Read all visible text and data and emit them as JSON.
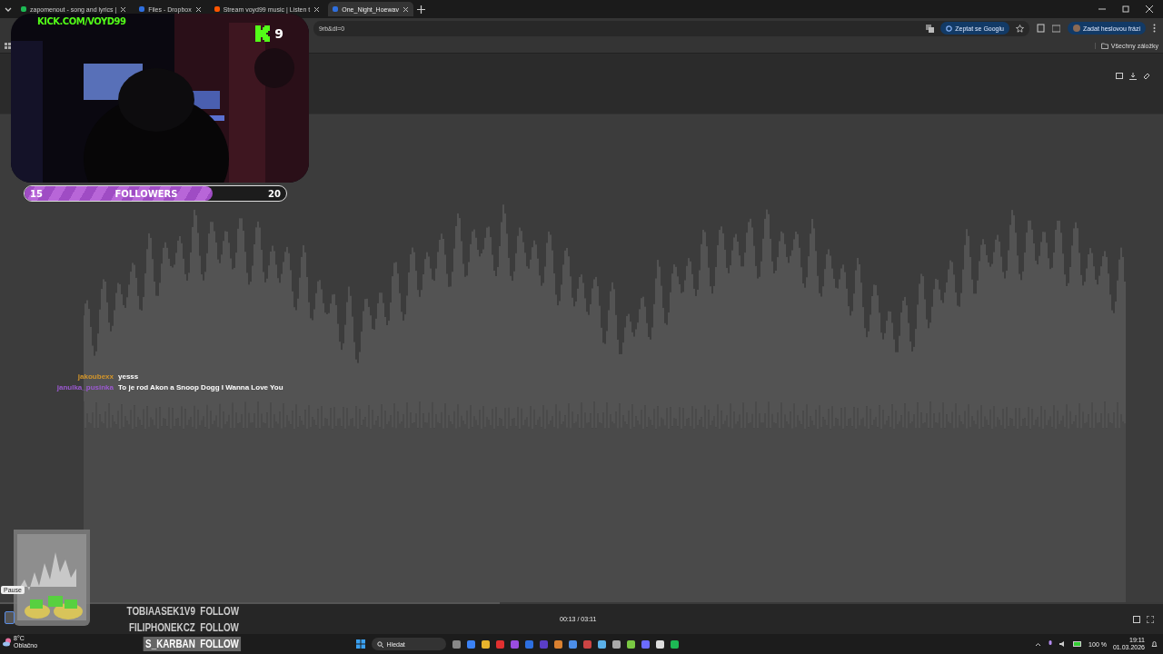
{
  "tabs": [
    {
      "title": "zapomenout - song and lyrics |",
      "selected": false
    },
    {
      "title": "Files - Dropbox",
      "selected": false
    },
    {
      "title": "Stream voyd99 music | Listen t",
      "selected": false
    },
    {
      "title": "One_Night_Hoewav",
      "selected": true
    }
  ],
  "address_fragment": "9rb&dl=0",
  "toolbar_buttons": [
    "Zeptat se Googlu",
    "Zadat heslovou frázi"
  ],
  "bookmarks": {
    "all": "Všechny záložky"
  },
  "overlay": {
    "channel": "KICK.COM/VOYD99",
    "viewers": "9",
    "followers": {
      "start": "15",
      "label": "FOLLOWERS",
      "goal": "20",
      "level": 0.72
    }
  },
  "chat": [
    {
      "user": "jakoubexx",
      "color": "#d4962a",
      "message": "yesss"
    },
    {
      "user": "janulka_pusinka",
      "color": "#9b59d0",
      "message": "To je rod Akon a Snoop Dogg I Wanna Love You"
    }
  ],
  "player": {
    "time": "00:13 / 03:11",
    "progress": {
      "level": 0.43
    },
    "tooltip": "Pause"
  },
  "recent_follows": [
    {
      "name": "TOBIAASEK1V9",
      "action": "FOLLOW",
      "selected": false
    },
    {
      "name": "FILIPHONEKCZ",
      "action": "FOLLOW",
      "selected": false
    },
    {
      "name": "S_KARBAN",
      "action": "FOLLOW",
      "selected": true
    }
  ],
  "weather": {
    "temp": "8°C",
    "condition": "Oblačno"
  },
  "taskbar": {
    "search": "Hledat",
    "battery": "100 %",
    "time": "19:11",
    "date": "01.03.2026"
  }
}
